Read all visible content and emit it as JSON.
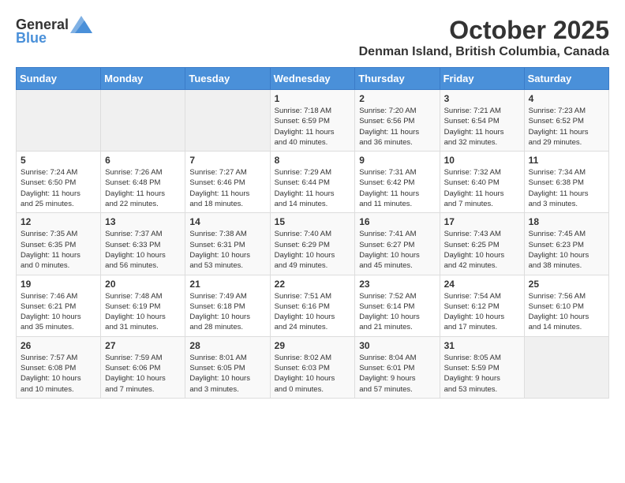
{
  "header": {
    "logo_general": "General",
    "logo_blue": "Blue",
    "month_title": "October 2025",
    "location": "Denman Island, British Columbia, Canada"
  },
  "weekdays": [
    "Sunday",
    "Monday",
    "Tuesday",
    "Wednesday",
    "Thursday",
    "Friday",
    "Saturday"
  ],
  "weeks": [
    [
      {
        "day": "",
        "info": ""
      },
      {
        "day": "",
        "info": ""
      },
      {
        "day": "",
        "info": ""
      },
      {
        "day": "1",
        "info": "Sunrise: 7:18 AM\nSunset: 6:59 PM\nDaylight: 11 hours\nand 40 minutes."
      },
      {
        "day": "2",
        "info": "Sunrise: 7:20 AM\nSunset: 6:56 PM\nDaylight: 11 hours\nand 36 minutes."
      },
      {
        "day": "3",
        "info": "Sunrise: 7:21 AM\nSunset: 6:54 PM\nDaylight: 11 hours\nand 32 minutes."
      },
      {
        "day": "4",
        "info": "Sunrise: 7:23 AM\nSunset: 6:52 PM\nDaylight: 11 hours\nand 29 minutes."
      }
    ],
    [
      {
        "day": "5",
        "info": "Sunrise: 7:24 AM\nSunset: 6:50 PM\nDaylight: 11 hours\nand 25 minutes."
      },
      {
        "day": "6",
        "info": "Sunrise: 7:26 AM\nSunset: 6:48 PM\nDaylight: 11 hours\nand 22 minutes."
      },
      {
        "day": "7",
        "info": "Sunrise: 7:27 AM\nSunset: 6:46 PM\nDaylight: 11 hours\nand 18 minutes."
      },
      {
        "day": "8",
        "info": "Sunrise: 7:29 AM\nSunset: 6:44 PM\nDaylight: 11 hours\nand 14 minutes."
      },
      {
        "day": "9",
        "info": "Sunrise: 7:31 AM\nSunset: 6:42 PM\nDaylight: 11 hours\nand 11 minutes."
      },
      {
        "day": "10",
        "info": "Sunrise: 7:32 AM\nSunset: 6:40 PM\nDaylight: 11 hours\nand 7 minutes."
      },
      {
        "day": "11",
        "info": "Sunrise: 7:34 AM\nSunset: 6:38 PM\nDaylight: 11 hours\nand 3 minutes."
      }
    ],
    [
      {
        "day": "12",
        "info": "Sunrise: 7:35 AM\nSunset: 6:35 PM\nDaylight: 11 hours\nand 0 minutes."
      },
      {
        "day": "13",
        "info": "Sunrise: 7:37 AM\nSunset: 6:33 PM\nDaylight: 10 hours\nand 56 minutes."
      },
      {
        "day": "14",
        "info": "Sunrise: 7:38 AM\nSunset: 6:31 PM\nDaylight: 10 hours\nand 53 minutes."
      },
      {
        "day": "15",
        "info": "Sunrise: 7:40 AM\nSunset: 6:29 PM\nDaylight: 10 hours\nand 49 minutes."
      },
      {
        "day": "16",
        "info": "Sunrise: 7:41 AM\nSunset: 6:27 PM\nDaylight: 10 hours\nand 45 minutes."
      },
      {
        "day": "17",
        "info": "Sunrise: 7:43 AM\nSunset: 6:25 PM\nDaylight: 10 hours\nand 42 minutes."
      },
      {
        "day": "18",
        "info": "Sunrise: 7:45 AM\nSunset: 6:23 PM\nDaylight: 10 hours\nand 38 minutes."
      }
    ],
    [
      {
        "day": "19",
        "info": "Sunrise: 7:46 AM\nSunset: 6:21 PM\nDaylight: 10 hours\nand 35 minutes."
      },
      {
        "day": "20",
        "info": "Sunrise: 7:48 AM\nSunset: 6:19 PM\nDaylight: 10 hours\nand 31 minutes."
      },
      {
        "day": "21",
        "info": "Sunrise: 7:49 AM\nSunset: 6:18 PM\nDaylight: 10 hours\nand 28 minutes."
      },
      {
        "day": "22",
        "info": "Sunrise: 7:51 AM\nSunset: 6:16 PM\nDaylight: 10 hours\nand 24 minutes."
      },
      {
        "day": "23",
        "info": "Sunrise: 7:52 AM\nSunset: 6:14 PM\nDaylight: 10 hours\nand 21 minutes."
      },
      {
        "day": "24",
        "info": "Sunrise: 7:54 AM\nSunset: 6:12 PM\nDaylight: 10 hours\nand 17 minutes."
      },
      {
        "day": "25",
        "info": "Sunrise: 7:56 AM\nSunset: 6:10 PM\nDaylight: 10 hours\nand 14 minutes."
      }
    ],
    [
      {
        "day": "26",
        "info": "Sunrise: 7:57 AM\nSunset: 6:08 PM\nDaylight: 10 hours\nand 10 minutes."
      },
      {
        "day": "27",
        "info": "Sunrise: 7:59 AM\nSunset: 6:06 PM\nDaylight: 10 hours\nand 7 minutes."
      },
      {
        "day": "28",
        "info": "Sunrise: 8:01 AM\nSunset: 6:05 PM\nDaylight: 10 hours\nand 3 minutes."
      },
      {
        "day": "29",
        "info": "Sunrise: 8:02 AM\nSunset: 6:03 PM\nDaylight: 10 hours\nand 0 minutes."
      },
      {
        "day": "30",
        "info": "Sunrise: 8:04 AM\nSunset: 6:01 PM\nDaylight: 9 hours\nand 57 minutes."
      },
      {
        "day": "31",
        "info": "Sunrise: 8:05 AM\nSunset: 5:59 PM\nDaylight: 9 hours\nand 53 minutes."
      },
      {
        "day": "",
        "info": ""
      }
    ]
  ]
}
